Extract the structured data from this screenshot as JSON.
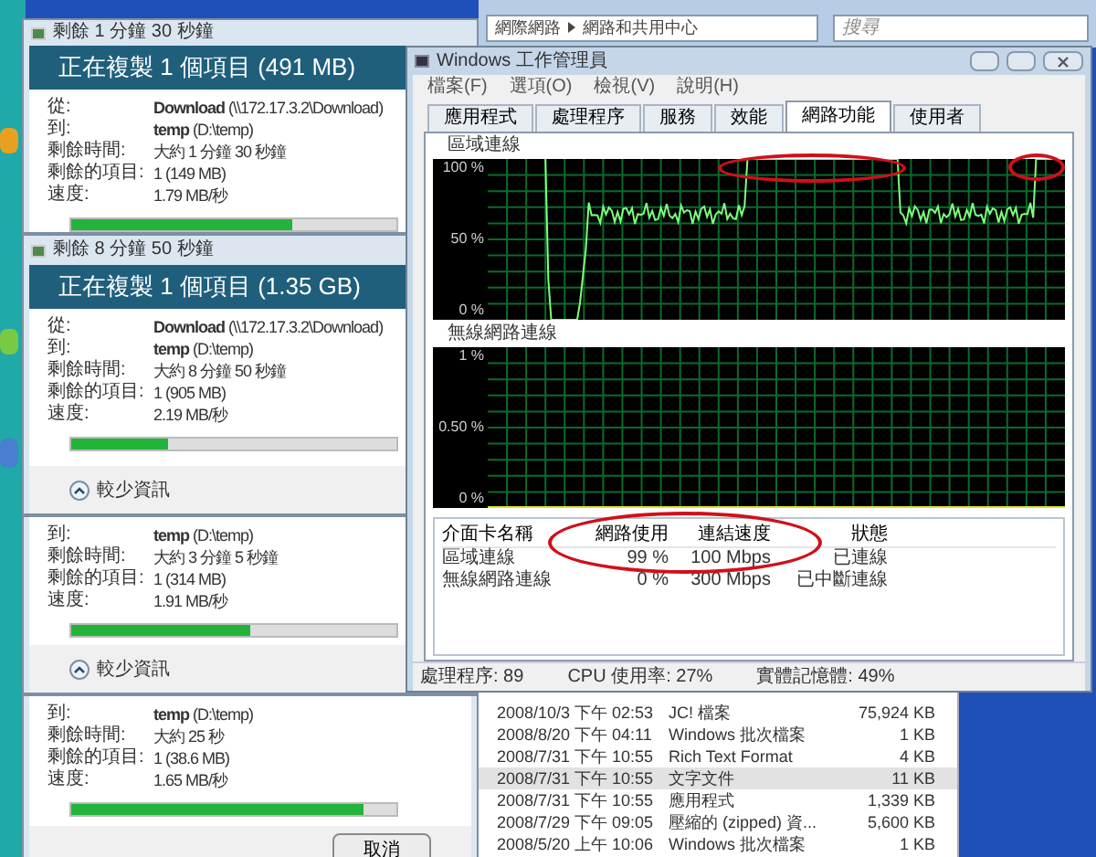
{
  "copy_dialogs": [
    {
      "title": "剩餘 1 分鐘 30 秒鐘",
      "header": "正在複製 1 個項目 (491 MB)",
      "rows": [
        {
          "label": "從:",
          "value": "**Download** (\\\\172.17.3.2\\Download)"
        },
        {
          "label": "到:",
          "value": "**temp** (D:\\temp)"
        },
        {
          "label": "剩餘時間:",
          "value": "大約 1 分鐘 30 秒鐘"
        },
        {
          "label": "剩餘的項目:",
          "value": "1 (149 MB)"
        },
        {
          "label": "速度:",
          "value": "1.79 MB/秒"
        }
      ],
      "progress": {
        "level": 0.68
      }
    },
    {
      "title": "剩餘 8 分鐘 50 秒鐘",
      "header": "正在複製 1 個項目 (1.35 GB)",
      "rows": [
        {
          "label": "從:",
          "value": "**Download** (\\\\172.17.3.2\\Download)"
        },
        {
          "label": "到:",
          "value": "**temp** (D:\\temp)"
        },
        {
          "label": "剩餘時間:",
          "value": "大約 8 分鐘 50 秒鐘"
        },
        {
          "label": "剩餘的項目:",
          "value": "1 (905 MB)"
        },
        {
          "label": "速度:",
          "value": "2.19 MB/秒"
        }
      ],
      "progress": {
        "level": 0.3
      },
      "less_info": "較少資訊"
    },
    {
      "rows": [
        {
          "label": "到:",
          "value": "**temp** (D:\\temp)"
        },
        {
          "label": "剩餘時間:",
          "value": "大約 3 分鐘 5 秒鐘"
        },
        {
          "label": "剩餘的項目:",
          "value": "1 (314 MB)"
        },
        {
          "label": "速度:",
          "value": "1.91 MB/秒"
        }
      ],
      "progress": {
        "level": 0.55
      },
      "less_info": "較少資訊"
    },
    {
      "rows": [
        {
          "label": "到:",
          "value": "**temp** (D:\\temp)"
        },
        {
          "label": "剩餘時間:",
          "value": "大約 25 秒"
        },
        {
          "label": "剩餘的項目:",
          "value": "1 (38.6 MB)"
        },
        {
          "label": "速度:",
          "value": "1.65 MB/秒"
        }
      ],
      "progress": {
        "level": 0.9
      },
      "cancel": "取消"
    }
  ],
  "explorer": {
    "breadcrumb": [
      "網際網路",
      "網路和共用中心"
    ],
    "search": {
      "placeholder": "搜尋"
    },
    "files": [
      {
        "date": "2008/10/3 下午 02:53",
        "type": "JC! 檔案",
        "size": "75,924 KB",
        "selected": false
      },
      {
        "date": "2008/8/20 下午 04:11",
        "type": "Windows 批次檔案",
        "size": "1 KB",
        "selected": false
      },
      {
        "date": "2008/7/31 下午 10:55",
        "type": "Rich Text Format",
        "size": "4 KB",
        "selected": false
      },
      {
        "date": "2008/7/31 下午 10:55",
        "type": "文字文件",
        "size": "11 KB",
        "selected": true
      },
      {
        "date": "2008/7/31 下午 10:55",
        "type": "應用程式",
        "size": "1,339 KB",
        "selected": false
      },
      {
        "date": "2008/7/29 下午 09:05",
        "type": "壓縮的 (zipped) 資...",
        "size": "5,600 KB",
        "selected": false
      },
      {
        "date": "2008/5/20 上午 10:06",
        "type": "Windows 批次檔案",
        "size": "1 KB",
        "selected": false
      }
    ]
  },
  "task_manager": {
    "title": "Windows 工作管理員",
    "menu": [
      "檔案(F)",
      "選項(O)",
      "檢視(V)",
      "說明(H)"
    ],
    "tabs": [
      {
        "label": "應用程式",
        "selected": false
      },
      {
        "label": "處理程序",
        "selected": false
      },
      {
        "label": "服務",
        "selected": false
      },
      {
        "label": "效能",
        "selected": false
      },
      {
        "label": "網路功能",
        "selected": true
      },
      {
        "label": "使用者",
        "selected": false
      }
    ],
    "graphs": [
      {
        "label": "區域連線",
        "y_labels": [
          "100 %",
          "50 %",
          "0 %"
        ],
        "kind": "traffic"
      },
      {
        "label": "無線網路連線",
        "y_labels": [
          "1 %",
          "0.50 %",
          "0 %"
        ],
        "kind": "idle"
      }
    ],
    "table": {
      "columns": [
        "介面卡名稱",
        "網路使用",
        "連結速度",
        "狀態"
      ],
      "rows": [
        [
          "區域連線",
          "99 %",
          "100 Mbps",
          "已連線"
        ],
        [
          "無線網路連線",
          "0 %",
          "300 Mbps",
          "已中斷連線"
        ]
      ]
    },
    "status_bar": [
      "處理程序: 89",
      "CPU 使用率: 27%",
      "實體記憶體: 49%"
    ]
  }
}
